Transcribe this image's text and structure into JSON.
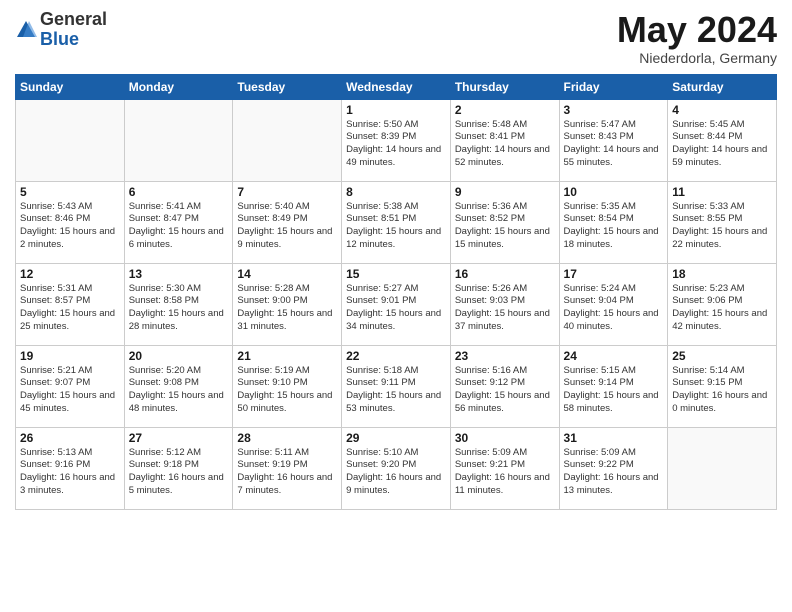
{
  "header": {
    "logo_general": "General",
    "logo_blue": "Blue",
    "month": "May 2024",
    "location": "Niederdorla, Germany"
  },
  "weekdays": [
    "Sunday",
    "Monday",
    "Tuesday",
    "Wednesday",
    "Thursday",
    "Friday",
    "Saturday"
  ],
  "weeks": [
    [
      {
        "day": "",
        "info": ""
      },
      {
        "day": "",
        "info": ""
      },
      {
        "day": "",
        "info": ""
      },
      {
        "day": "1",
        "info": "Sunrise: 5:50 AM\nSunset: 8:39 PM\nDaylight: 14 hours\nand 49 minutes."
      },
      {
        "day": "2",
        "info": "Sunrise: 5:48 AM\nSunset: 8:41 PM\nDaylight: 14 hours\nand 52 minutes."
      },
      {
        "day": "3",
        "info": "Sunrise: 5:47 AM\nSunset: 8:43 PM\nDaylight: 14 hours\nand 55 minutes."
      },
      {
        "day": "4",
        "info": "Sunrise: 5:45 AM\nSunset: 8:44 PM\nDaylight: 14 hours\nand 59 minutes."
      }
    ],
    [
      {
        "day": "5",
        "info": "Sunrise: 5:43 AM\nSunset: 8:46 PM\nDaylight: 15 hours\nand 2 minutes."
      },
      {
        "day": "6",
        "info": "Sunrise: 5:41 AM\nSunset: 8:47 PM\nDaylight: 15 hours\nand 6 minutes."
      },
      {
        "day": "7",
        "info": "Sunrise: 5:40 AM\nSunset: 8:49 PM\nDaylight: 15 hours\nand 9 minutes."
      },
      {
        "day": "8",
        "info": "Sunrise: 5:38 AM\nSunset: 8:51 PM\nDaylight: 15 hours\nand 12 minutes."
      },
      {
        "day": "9",
        "info": "Sunrise: 5:36 AM\nSunset: 8:52 PM\nDaylight: 15 hours\nand 15 minutes."
      },
      {
        "day": "10",
        "info": "Sunrise: 5:35 AM\nSunset: 8:54 PM\nDaylight: 15 hours\nand 18 minutes."
      },
      {
        "day": "11",
        "info": "Sunrise: 5:33 AM\nSunset: 8:55 PM\nDaylight: 15 hours\nand 22 minutes."
      }
    ],
    [
      {
        "day": "12",
        "info": "Sunrise: 5:31 AM\nSunset: 8:57 PM\nDaylight: 15 hours\nand 25 minutes."
      },
      {
        "day": "13",
        "info": "Sunrise: 5:30 AM\nSunset: 8:58 PM\nDaylight: 15 hours\nand 28 minutes."
      },
      {
        "day": "14",
        "info": "Sunrise: 5:28 AM\nSunset: 9:00 PM\nDaylight: 15 hours\nand 31 minutes."
      },
      {
        "day": "15",
        "info": "Sunrise: 5:27 AM\nSunset: 9:01 PM\nDaylight: 15 hours\nand 34 minutes."
      },
      {
        "day": "16",
        "info": "Sunrise: 5:26 AM\nSunset: 9:03 PM\nDaylight: 15 hours\nand 37 minutes."
      },
      {
        "day": "17",
        "info": "Sunrise: 5:24 AM\nSunset: 9:04 PM\nDaylight: 15 hours\nand 40 minutes."
      },
      {
        "day": "18",
        "info": "Sunrise: 5:23 AM\nSunset: 9:06 PM\nDaylight: 15 hours\nand 42 minutes."
      }
    ],
    [
      {
        "day": "19",
        "info": "Sunrise: 5:21 AM\nSunset: 9:07 PM\nDaylight: 15 hours\nand 45 minutes."
      },
      {
        "day": "20",
        "info": "Sunrise: 5:20 AM\nSunset: 9:08 PM\nDaylight: 15 hours\nand 48 minutes."
      },
      {
        "day": "21",
        "info": "Sunrise: 5:19 AM\nSunset: 9:10 PM\nDaylight: 15 hours\nand 50 minutes."
      },
      {
        "day": "22",
        "info": "Sunrise: 5:18 AM\nSunset: 9:11 PM\nDaylight: 15 hours\nand 53 minutes."
      },
      {
        "day": "23",
        "info": "Sunrise: 5:16 AM\nSunset: 9:12 PM\nDaylight: 15 hours\nand 56 minutes."
      },
      {
        "day": "24",
        "info": "Sunrise: 5:15 AM\nSunset: 9:14 PM\nDaylight: 15 hours\nand 58 minutes."
      },
      {
        "day": "25",
        "info": "Sunrise: 5:14 AM\nSunset: 9:15 PM\nDaylight: 16 hours\nand 0 minutes."
      }
    ],
    [
      {
        "day": "26",
        "info": "Sunrise: 5:13 AM\nSunset: 9:16 PM\nDaylight: 16 hours\nand 3 minutes."
      },
      {
        "day": "27",
        "info": "Sunrise: 5:12 AM\nSunset: 9:18 PM\nDaylight: 16 hours\nand 5 minutes."
      },
      {
        "day": "28",
        "info": "Sunrise: 5:11 AM\nSunset: 9:19 PM\nDaylight: 16 hours\nand 7 minutes."
      },
      {
        "day": "29",
        "info": "Sunrise: 5:10 AM\nSunset: 9:20 PM\nDaylight: 16 hours\nand 9 minutes."
      },
      {
        "day": "30",
        "info": "Sunrise: 5:09 AM\nSunset: 9:21 PM\nDaylight: 16 hours\nand 11 minutes."
      },
      {
        "day": "31",
        "info": "Sunrise: 5:09 AM\nSunset: 9:22 PM\nDaylight: 16 hours\nand 13 minutes."
      },
      {
        "day": "",
        "info": ""
      }
    ]
  ]
}
